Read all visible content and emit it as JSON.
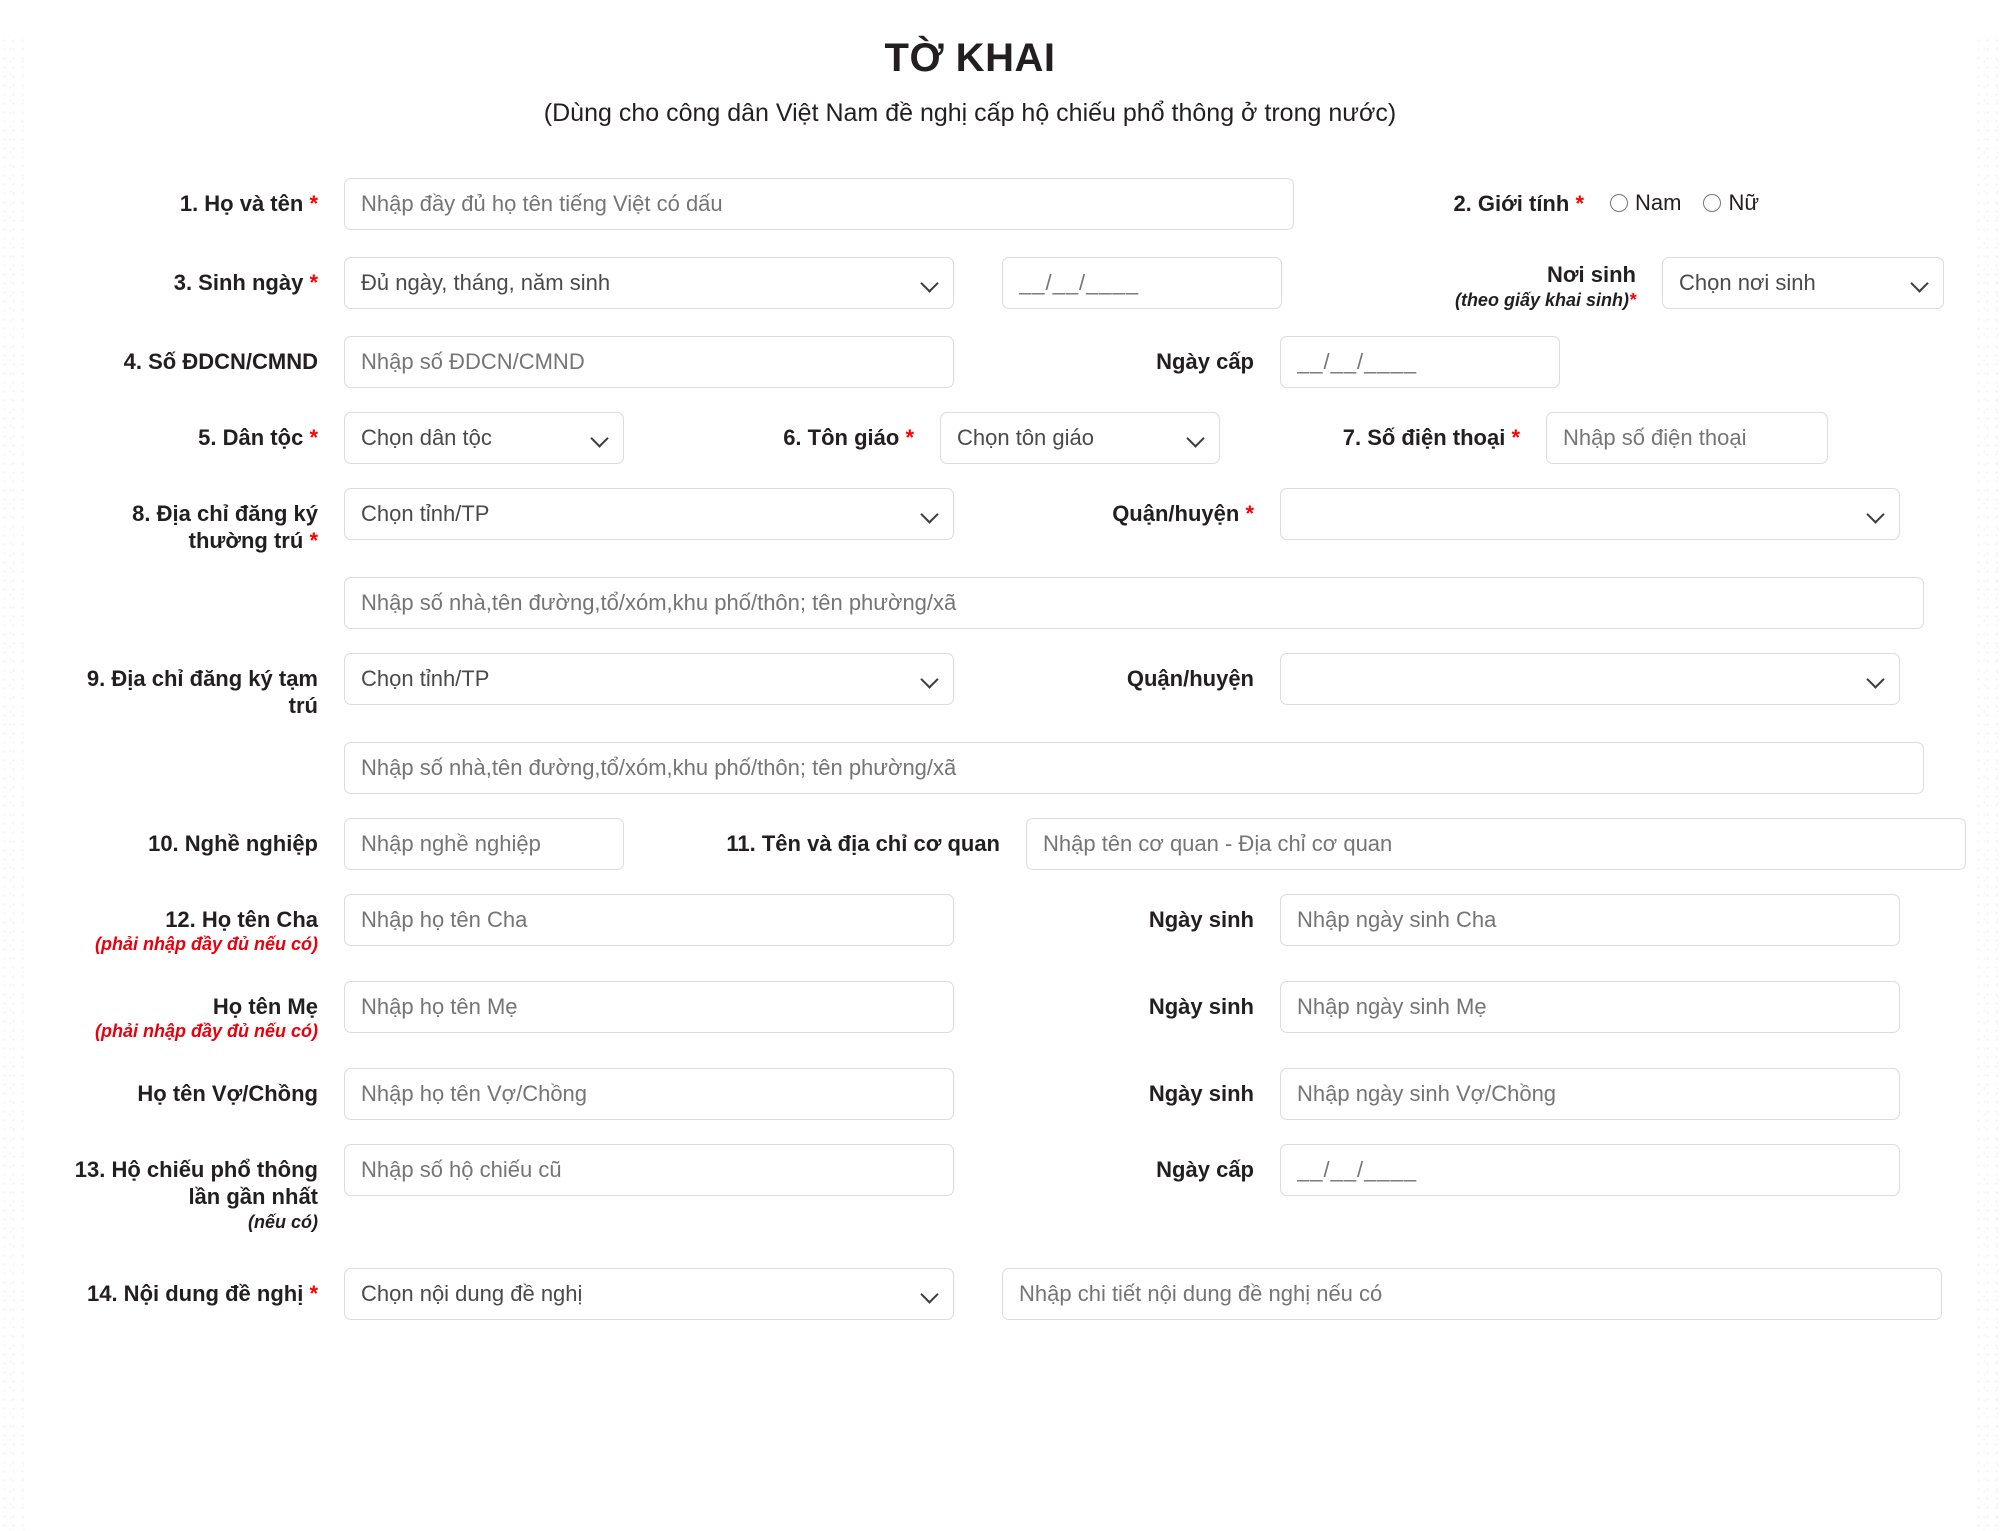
{
  "header": {
    "title": "TỜ KHAI",
    "subtitle": "(Dùng cho công dân Việt Nam đề nghị cấp hộ chiếu phổ thông ở trong nước)"
  },
  "fields": {
    "full_name": {
      "label": "1. Họ và tên",
      "required": "*",
      "placeholder": "Nhập đầy đủ họ tên tiếng Việt có dấu"
    },
    "gender": {
      "label": "2. Giới tính",
      "required": "*",
      "options": [
        "Nam",
        "Nữ"
      ]
    },
    "birth_date": {
      "label": "3. Sinh ngày",
      "required": "*",
      "select_value": "Đủ ngày, tháng, năm sinh",
      "date_placeholder": "__/__/____"
    },
    "birth_place": {
      "label": "Nơi sinh",
      "note": "(theo giấy khai sinh)",
      "required": "*",
      "select_value": "Chọn nơi sinh"
    },
    "id_number": {
      "label": "4. Số ĐDCN/CMND",
      "placeholder": "Nhập số ĐDCN/CMND"
    },
    "id_issue_date": {
      "label": "Ngày cấp",
      "date_placeholder": "__/__/____"
    },
    "ethnicity": {
      "label": "5. Dân tộc",
      "required": "*",
      "select_value": "Chọn dân tộc"
    },
    "religion": {
      "label": "6. Tôn giáo",
      "required": "*",
      "select_value": "Chọn tôn giáo"
    },
    "phone": {
      "label": "7. Số điện thoại",
      "required": "*",
      "placeholder": "Nhập số điện thoại"
    },
    "permanent_address": {
      "label": "8. Địa chỉ đăng ký thường trú",
      "required": "*",
      "province_value": "Chọn tỉnh/TP",
      "district_label": "Quận/huyện",
      "district_required": "*",
      "district_value": "",
      "detail_placeholder": "Nhập số nhà,tên đường,tổ/xóm,khu phố/thôn; tên phường/xã"
    },
    "temporary_address": {
      "label": "9. Địa chỉ đăng ký tạm trú",
      "province_value": "Chọn tỉnh/TP",
      "district_label": "Quận/huyện",
      "district_value": "",
      "detail_placeholder": "Nhập số nhà,tên đường,tổ/xóm,khu phố/thôn; tên phường/xã"
    },
    "occupation": {
      "label": "10. Nghề nghiệp",
      "placeholder": "Nhập nghề nghiệp"
    },
    "workplace": {
      "label": "11. Tên và địa chỉ cơ quan",
      "placeholder": "Nhập tên cơ quan - Địa chỉ cơ quan"
    },
    "father": {
      "label": "12. Họ tên Cha",
      "note": "(phải nhập đầy đủ nếu có)",
      "placeholder": "Nhập họ tên Cha",
      "dob_label": "Ngày sinh",
      "dob_placeholder": "Nhập ngày sinh Cha"
    },
    "mother": {
      "label": "Họ tên Mẹ",
      "note": "(phải nhập đầy đủ nếu có)",
      "placeholder": "Nhập họ tên Mẹ",
      "dob_label": "Ngày sinh",
      "dob_placeholder": "Nhập ngày sinh Mẹ"
    },
    "spouse": {
      "label": "Họ tên Vợ/Chồng",
      "placeholder": "Nhập họ tên Vợ/Chồng",
      "dob_label": "Ngày sinh",
      "dob_placeholder": "Nhập ngày sinh Vợ/Chồng"
    },
    "previous_passport": {
      "label": "13. Hộ chiếu phổ thông lần gần nhất",
      "note": "(nếu có)",
      "placeholder": "Nhập số hộ chiếu cũ",
      "issue_label": "Ngày cấp",
      "issue_placeholder": "__/__/____"
    },
    "request_content": {
      "label": "14. Nội dung đề nghị",
      "required": "*",
      "select_value": "Chọn nội dung đề nghị",
      "detail_placeholder": "Nhập chi tiết nội dung đề nghị nếu có"
    }
  }
}
